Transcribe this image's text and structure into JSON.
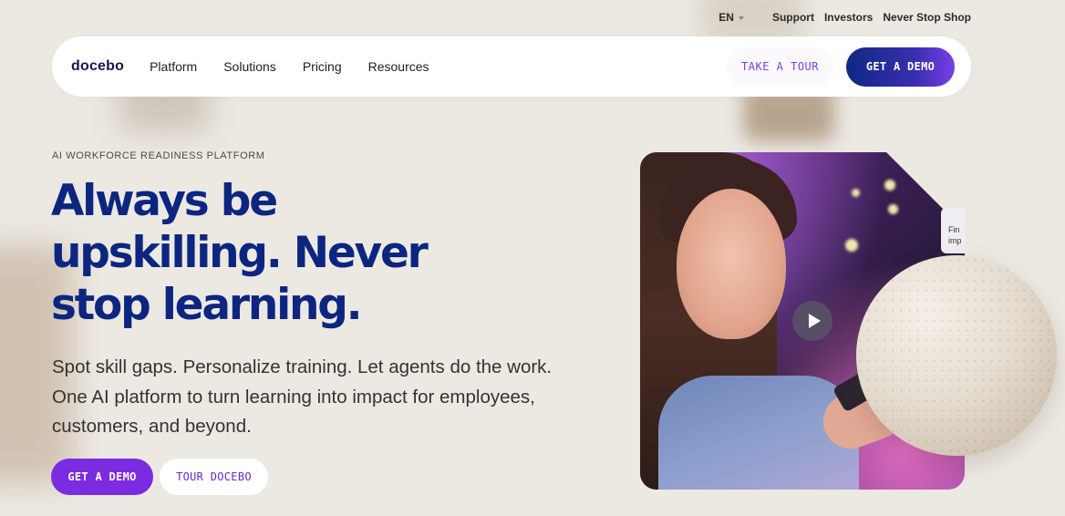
{
  "utility_nav": {
    "language": "EN",
    "links": [
      "Support",
      "Investors",
      "Never Stop Shop"
    ]
  },
  "nav": {
    "logo": "docebo",
    "menu": [
      "Platform",
      "Solutions",
      "Pricing",
      "Resources"
    ],
    "tour_label": "TAKE A TOUR",
    "demo_label": "GET A DEMO"
  },
  "hero": {
    "eyebrow": "AI WORKFORCE READINESS PLATFORM",
    "headline_lines": [
      "Always be",
      "upskilling. Never",
      "stop learning."
    ],
    "subtext_lines": [
      "Spot skill gaps. Personalize training. Let agents do the work.",
      "One AI platform to turn learning into impact for employees,",
      "customers, and beyond."
    ],
    "cta_primary": "GET A DEMO",
    "cta_secondary": "TOUR DOCEBO"
  },
  "video_card": {
    "mini_card_lines": [
      "Fin",
      "imp"
    ]
  },
  "colors": {
    "background": "#ece9e3",
    "headline": "#0c2680",
    "accent_purple": "#7b2be0",
    "navy": "#0e2883"
  },
  "icons": [
    "chevron-down-icon",
    "play-icon"
  ]
}
